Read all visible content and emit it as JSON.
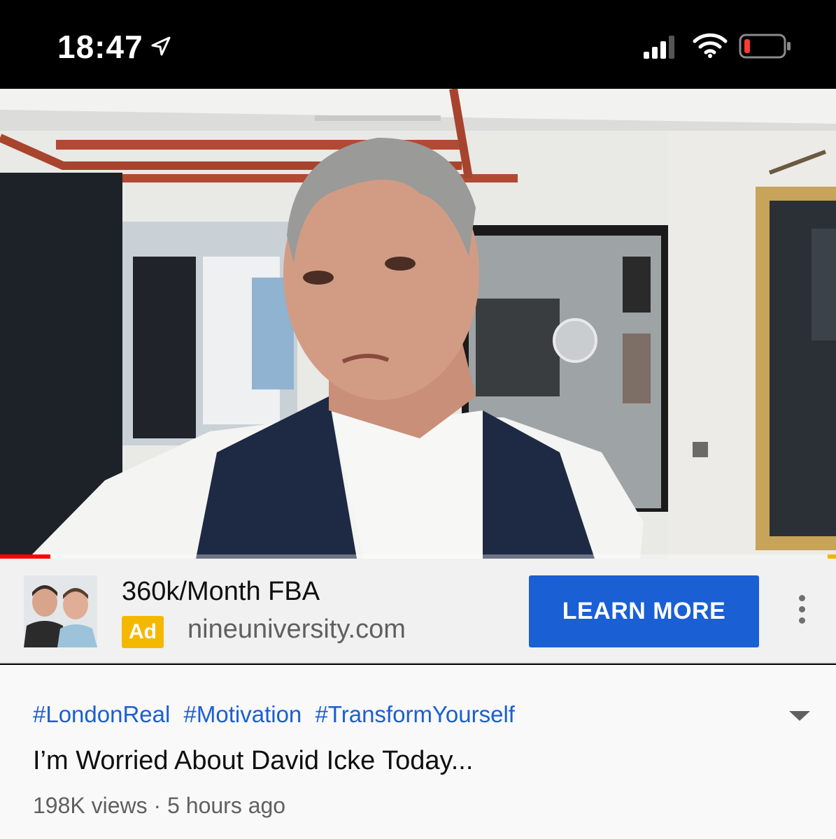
{
  "status_bar": {
    "time": "18:47",
    "icons": [
      "location-arrow-icon",
      "cellular-signal-icon",
      "wifi-icon",
      "battery-low-icon"
    ],
    "battery_color": "#ff3b30"
  },
  "video": {
    "progress": 0.06,
    "progress_color": "#ff0000"
  },
  "ad": {
    "title": "360k/Month FBA",
    "badge": "Ad",
    "domain": "nineuniversity.com",
    "cta": "LEARN MORE",
    "cta_color": "#1a5fd4",
    "badge_color": "#f5b800"
  },
  "info": {
    "hashtags": [
      "#LondonReal",
      "#Motivation",
      "#TransformYourself"
    ],
    "title": "I’m Worried About David Icke Today...",
    "views": "198K views",
    "separator": "·",
    "age": "5 hours ago"
  }
}
